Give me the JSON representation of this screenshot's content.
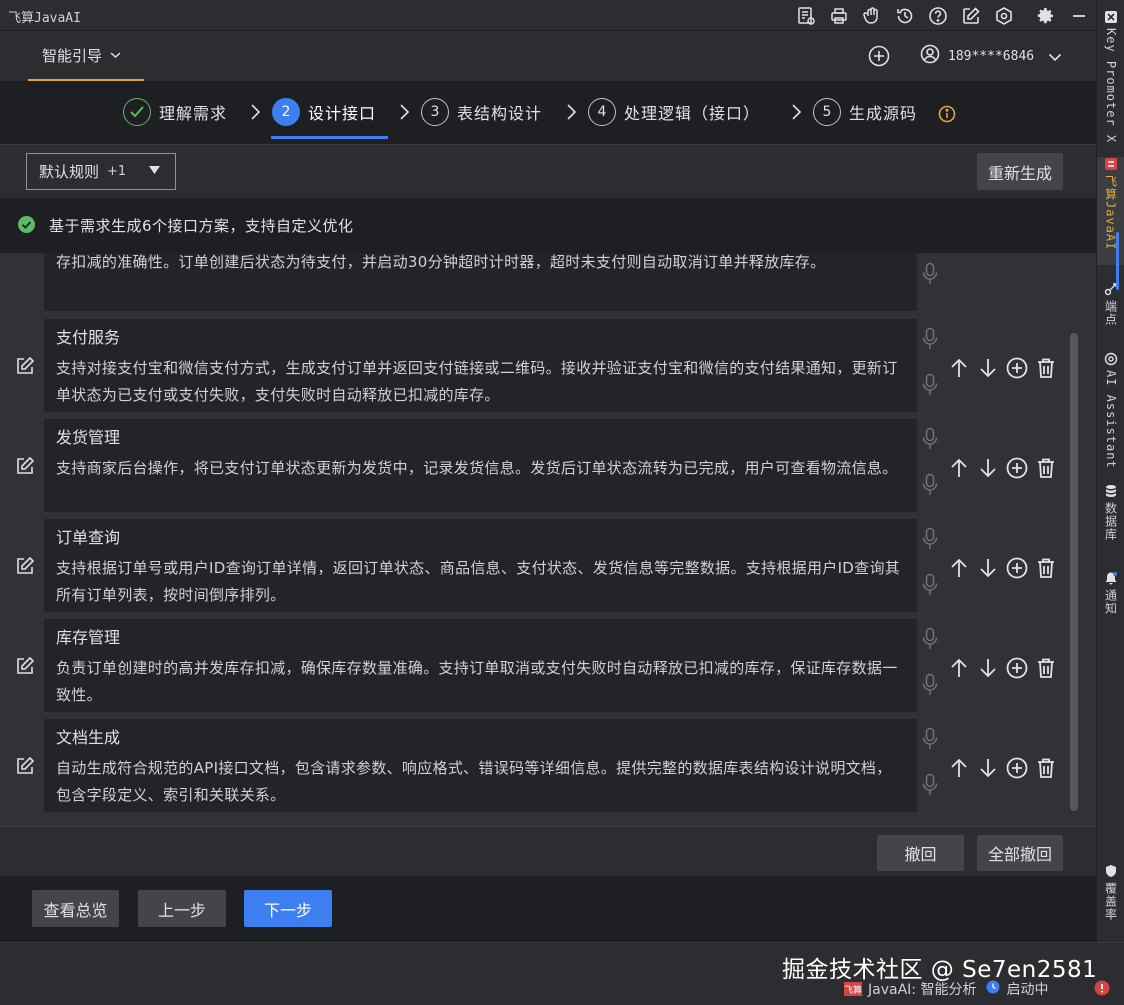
{
  "window": {
    "title": "飞算JavaAI",
    "toolbar_icons": [
      "document-settings-icon",
      "printer-icon",
      "hand-icon",
      "history-icon",
      "help-icon",
      "edit-icon",
      "hexagon-settings-icon",
      "gear-icon",
      "minimize-icon"
    ]
  },
  "header": {
    "guide_tab": "智能引导",
    "user_phone": "189****6846"
  },
  "steps": [
    {
      "num": "✓",
      "label": "理解需求",
      "state": "done"
    },
    {
      "num": "2",
      "label": "设计接口",
      "state": "active"
    },
    {
      "num": "3",
      "label": "表结构设计",
      "state": "pending"
    },
    {
      "num": "4",
      "label": "处理逻辑（接口）",
      "state": "pending"
    },
    {
      "num": "5",
      "label": "生成源码",
      "state": "pending"
    }
  ],
  "toolbar": {
    "rule_select": "默认规则",
    "rule_extra": "+1",
    "regenerate": "重新生成"
  },
  "notice": {
    "text": "基于需求生成6个接口方案，支持自定义优化"
  },
  "cards": [
    {
      "title": "",
      "desc": "存扣减的准确性。订单创建后状态为待支付，并启动30分钟超时计时器，超时未支付则自动取消订单并释放库存。",
      "partial": true
    },
    {
      "title": "支付服务",
      "desc": "支持对接支付宝和微信支付方式，生成支付订单并返回支付链接或二维码。接收并验证支付宝和微信的支付结果通知，更新订单状态为已支付或支付失败，支付失败时自动释放已扣减的库存。"
    },
    {
      "title": "发货管理",
      "desc": "支持商家后台操作，将已支付订单状态更新为发货中，记录发货信息。发货后订单状态流转为已完成，用户可查看物流信息。"
    },
    {
      "title": "订单查询",
      "desc": "支持根据订单号或用户ID查询订单详情，返回订单状态、商品信息、支付状态、发货信息等完整数据。支持根据用户ID查询其所有订单列表，按时间倒序排列。"
    },
    {
      "title": "库存管理",
      "desc": "负责订单创建时的高并发库存扣减，确保库存数量准确。支持订单取消或支付失败时自动释放已扣减的库存，保证库存数据一致性。"
    },
    {
      "title": "文档生成",
      "desc": "自动生成符合规范的API接口文档，包含请求参数、响应格式、错误码等详细信息。提供完整的数据库表结构设计说明文档，包含字段定义、索引和关联关系。"
    }
  ],
  "undo_bar": {
    "undo": "撤回",
    "undo_all": "全部撤回"
  },
  "footer": {
    "overview": "查看总览",
    "prev": "上一步",
    "next": "下一步"
  },
  "statusbar": {
    "watermark": "掘金技术社区 @ Se7en2581",
    "logo_text": "飞算",
    "plugin": "JavaAI: 智能分析",
    "starting": "启动中"
  },
  "right_sidebar": [
    {
      "label": "Key Promoter X",
      "icon": "key-promoter-icon"
    },
    {
      "label": "飞算JavaAI",
      "icon": "feisuan-logo-icon",
      "active": true
    },
    {
      "label": "端点",
      "icon": "endpoints-icon"
    },
    {
      "label": "AI Assistant",
      "icon": "ai-assistant-icon"
    },
    {
      "label": "数据库",
      "icon": "database-icon"
    },
    {
      "label": "通知",
      "icon": "bell-icon"
    },
    {
      "label": "覆盖率",
      "icon": "shield-icon"
    }
  ],
  "colors": {
    "accent_blue": "#3d7ff0",
    "accent_orange": "#e2a63b",
    "success_green": "#5fb865",
    "error_red": "#d64343"
  }
}
